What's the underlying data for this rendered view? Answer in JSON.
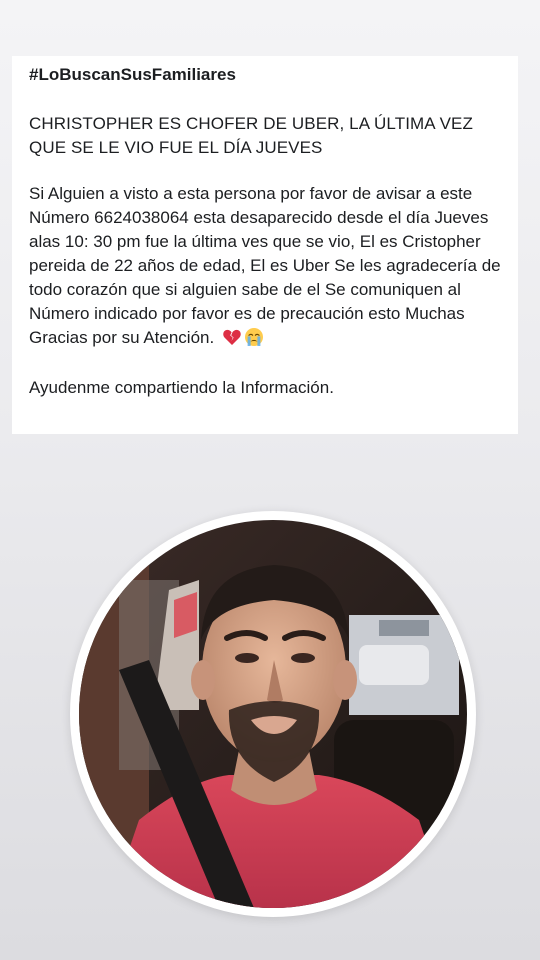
{
  "post": {
    "hashtag": "#LoBuscanSusFamiliares",
    "headline": "CHRISTOPHER ES CHOFER DE UBER, LA ÚLTIMA VEZ QUE SE LE VIO FUE EL DÍA JUEVES",
    "body": "Si Alguien a visto a esta persona por favor de avisar a este Número 6624038064 esta desaparecido desde el día Jueves alas 10: 30 pm fue la última ves que se vio, El es Cristopher pereida de 22 años de edad, El es Uber Se les agradecería de todo corazón que si alguien sabe de el Se comuniquen al Número indicado por favor es de precaución esto Muchas Gracias por su Atención.",
    "emojis": [
      "broken-heart-icon",
      "crying-face-icon"
    ],
    "closing": "Ayudenme compartiendo la Información."
  },
  "photo": {
    "subject": "missing-person-photo"
  }
}
